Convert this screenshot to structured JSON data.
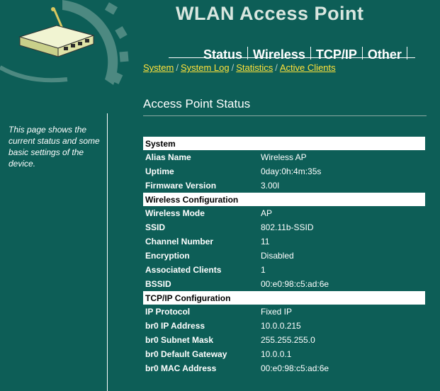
{
  "header": {
    "app_title": "WLAN Access Point"
  },
  "nav": {
    "tabs": [
      {
        "label": "Status"
      },
      {
        "label": "Wireless"
      },
      {
        "label": "TCP/IP"
      },
      {
        "label": "Other"
      }
    ],
    "subnav": [
      {
        "label": "System"
      },
      {
        "label": "System Log"
      },
      {
        "label": "Statistics"
      },
      {
        "label": "Active Clients"
      }
    ]
  },
  "sidebar": {
    "help_text": "This page shows the current status and some basic settings of the device."
  },
  "main": {
    "page_title": "Access Point Status",
    "sections": [
      {
        "title": "System",
        "rows": [
          {
            "label": "Alias Name",
            "value": "Wireless AP"
          },
          {
            "label": "Uptime",
            "value": "0day:0h:4m:35s"
          },
          {
            "label": "Firmware Version",
            "value": "3.00l"
          }
        ]
      },
      {
        "title": "Wireless Configuration",
        "rows": [
          {
            "label": "Wireless Mode",
            "value": "AP"
          },
          {
            "label": "SSID",
            "value": "802.11b-SSID"
          },
          {
            "label": "Channel Number",
            "value": "11"
          },
          {
            "label": "Encryption",
            "value": "Disabled"
          },
          {
            "label": "Associated Clients",
            "value": "1"
          },
          {
            "label": "BSSID",
            "value": "00:e0:98:c5:ad:6e"
          }
        ]
      },
      {
        "title": "TCP/IP Configuration",
        "rows": [
          {
            "label": "IP Protocol",
            "value": "Fixed IP"
          },
          {
            "label": "br0 IP Address",
            "value": "10.0.0.215"
          },
          {
            "label": "br0 Subnet Mask",
            "value": "255.255.255.0"
          },
          {
            "label": "br0 Default Gateway",
            "value": "10.0.0.1"
          },
          {
            "label": "br0 MAC Address",
            "value": "00:e0:98:c5:ad:6e"
          }
        ]
      }
    ]
  },
  "colors": {
    "background": "#0d5e57",
    "link": "#ffe23a",
    "section_header_bg": "#ffffff",
    "title": "#d8e6df"
  },
  "icons": {
    "logo": "router-icon",
    "decoration": "gear-arc-icon"
  }
}
